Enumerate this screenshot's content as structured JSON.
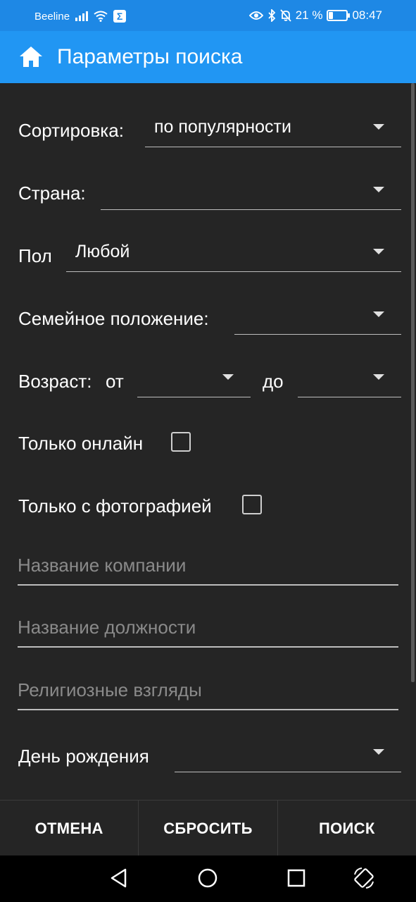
{
  "status_bar": {
    "carrier": "Beeline",
    "battery_percent": "21 %",
    "battery_level": 0.21,
    "time": "08:47",
    "icons": [
      "signal-icon",
      "wifi-icon",
      "sigma-icon",
      "eye-icon",
      "bluetooth-icon",
      "bell-off-icon",
      "battery-icon"
    ]
  },
  "app_bar": {
    "title": "Параметры поиска",
    "icon": "home-icon"
  },
  "form": {
    "sort": {
      "label": "Сортировка:",
      "value": "по популярности"
    },
    "country": {
      "label": "Страна:",
      "value": ""
    },
    "gender": {
      "label": "Пол",
      "value": "Любой"
    },
    "marital": {
      "label": "Семейное положение:",
      "value": ""
    },
    "age": {
      "label": "Возраст:",
      "from_label": "от",
      "from_value": "",
      "to_label": "до",
      "to_value": ""
    },
    "online_only": {
      "label": "Только онлайн",
      "checked": false
    },
    "photo_only": {
      "label": "Только с фотографией",
      "checked": false
    },
    "company": {
      "placeholder": "Название компании",
      "value": ""
    },
    "position": {
      "placeholder": "Название должности",
      "value": ""
    },
    "religion": {
      "placeholder": "Религиозные взгляды",
      "value": ""
    },
    "birthday": {
      "label": "День рождения",
      "value": ""
    }
  },
  "buttons": {
    "cancel": "ОТМЕНА",
    "reset": "СБРОСИТЬ",
    "search": "ПОИСК"
  },
  "nav_bar": {
    "icons": [
      "back-icon",
      "home-circle-icon",
      "recents-icon",
      "rotate-icon"
    ]
  }
}
